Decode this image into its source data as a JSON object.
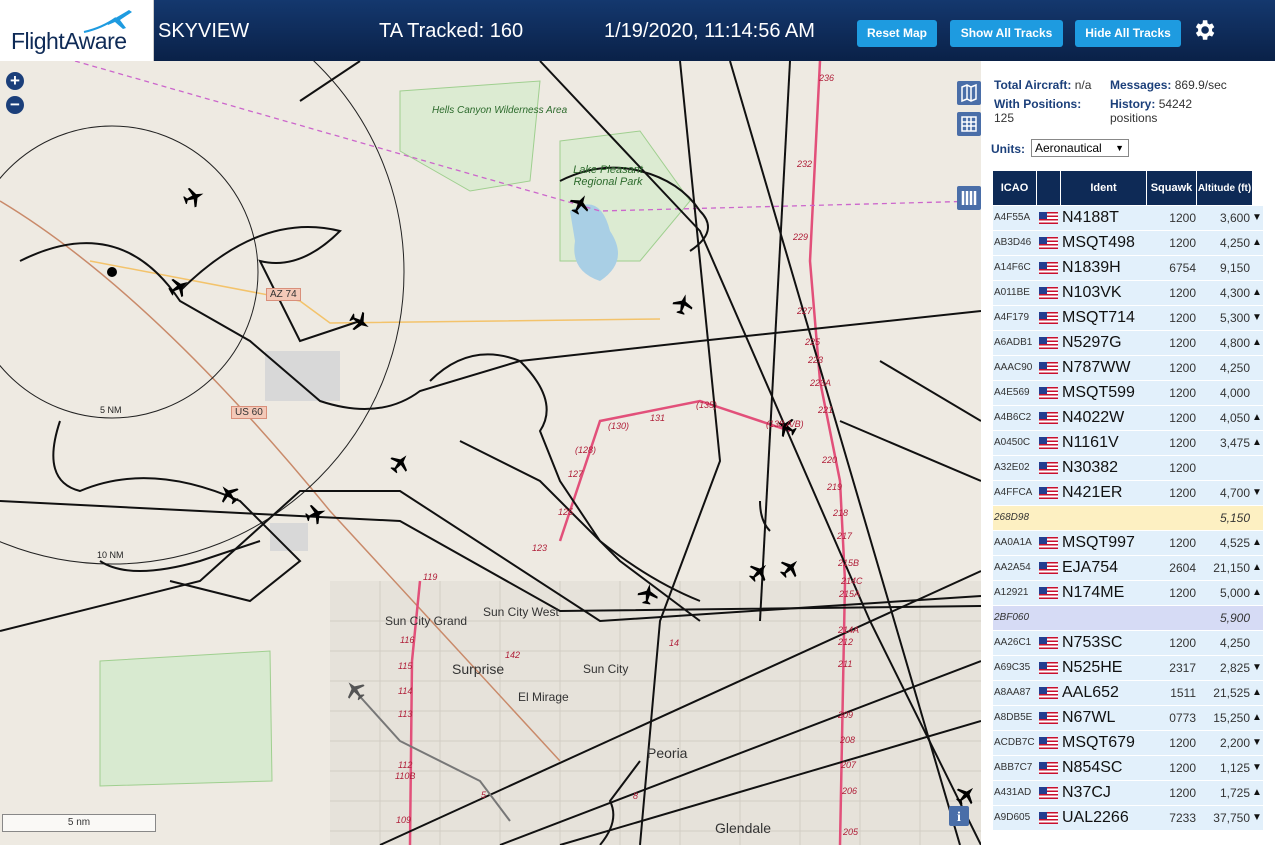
{
  "header": {
    "logo": "FlightAware",
    "app_name": "SKYVIEW",
    "tracked": "TA Tracked: 160",
    "datetime": "1/19/2020, 11:14:56 AM",
    "buttons": {
      "reset": "Reset Map",
      "show_all": "Show All Tracks",
      "hide_all": "Hide All Tracks"
    },
    "settings_icon": "gear-icon"
  },
  "map": {
    "zoom_in": "+",
    "zoom_out": "−",
    "scale": "5 nm",
    "range_labels": {
      "r5": "5 NM",
      "r10": "10 NM"
    },
    "road_badges": {
      "az74": "AZ 74",
      "us60": "US 60"
    },
    "places": {
      "hells_canyon": "Hells Canyon Wilderness Area",
      "lake_pleasant": "Lake Pleasant Regional Park",
      "sun_city_grand": "Sun City Grand",
      "sun_city_west": "Sun City West",
      "surprise": "Surprise",
      "sun_city": "Sun City",
      "el_mirage": "El Mirage",
      "peoria": "Peoria",
      "glendale": "Glendale"
    },
    "exits": [
      "236",
      "232",
      "229",
      "227",
      "225",
      "223",
      "223A",
      "221",
      "220",
      "219",
      "218",
      "217",
      "215B",
      "214C",
      "215A",
      "214A",
      "212",
      "211",
      "209",
      "208",
      "207",
      "206",
      "205",
      "119",
      "116",
      "115",
      "114",
      "113",
      "112",
      "110B",
      "109",
      "142",
      "131",
      "(130)",
      "(135)",
      "(128)",
      "127",
      "125",
      "123",
      "(138 A/B)",
      "14",
      "8",
      "5"
    ],
    "icons": {
      "map_view": "map-icon",
      "grid": "grid-icon",
      "columns": "columns-icon",
      "info": "info-icon"
    }
  },
  "sidebar": {
    "total_aircraft_label": "Total Aircraft:",
    "total_aircraft_value": "n/a",
    "messages_label": "Messages:",
    "messages_value": "869.9/sec",
    "with_positions_label": "With Positions:",
    "with_positions_value": "125",
    "history_label": "History:",
    "history_value": "54242 positions",
    "units_label": "Units:",
    "units_value": "Aeronautical",
    "columns": [
      "ICAO",
      "",
      "Ident",
      "Squawk",
      "Altitude (ft)"
    ],
    "rows": [
      {
        "icao": "A4F55A",
        "flag": true,
        "ident": "N4188T",
        "squawk": "1200",
        "alt": "3,600",
        "trend": "▼",
        "bg": "#e2f0fb"
      },
      {
        "icao": "AB3D46",
        "flag": true,
        "ident": "MSQT498",
        "squawk": "1200",
        "alt": "4,250",
        "trend": "▲",
        "bg": "#e2f0fb"
      },
      {
        "icao": "A14F6C",
        "flag": true,
        "ident": "N1839H",
        "squawk": "6754",
        "alt": "9,150",
        "trend": "",
        "bg": "#e2f0fb"
      },
      {
        "icao": "A011BE",
        "flag": true,
        "ident": "N103VK",
        "squawk": "1200",
        "alt": "4,300",
        "trend": "▲",
        "bg": "#e2f0fb"
      },
      {
        "icao": "A4F179",
        "flag": true,
        "ident": "MSQT714",
        "squawk": "1200",
        "alt": "5,300",
        "trend": "▼",
        "bg": "#e2f0fb"
      },
      {
        "icao": "A6ADB1",
        "flag": true,
        "ident": "N5297G",
        "squawk": "1200",
        "alt": "4,800",
        "trend": "▲",
        "bg": "#e2f0fb"
      },
      {
        "icao": "AAAC90",
        "flag": true,
        "ident": "N787WW",
        "squawk": "1200",
        "alt": "4,250",
        "trend": "",
        "bg": "#e2f0fb"
      },
      {
        "icao": "A4E569",
        "flag": true,
        "ident": "MSQT599",
        "squawk": "1200",
        "alt": "4,000",
        "trend": "",
        "bg": "#e2f0fb"
      },
      {
        "icao": "A4B6C2",
        "flag": true,
        "ident": "N4022W",
        "squawk": "1200",
        "alt": "4,050",
        "trend": "▲",
        "bg": "#e2f0fb"
      },
      {
        "icao": "A0450C",
        "flag": true,
        "ident": "N1161V",
        "squawk": "1200",
        "alt": "3,475",
        "trend": "▲",
        "bg": "#e2f0fb"
      },
      {
        "icao": "A32E02",
        "flag": true,
        "ident": "N30382",
        "squawk": "1200",
        "alt": "",
        "trend": "",
        "bg": "#e2f0fb"
      },
      {
        "icao": "A4FFCA",
        "flag": true,
        "ident": "N421ER",
        "squawk": "1200",
        "alt": "4,700",
        "trend": "▼",
        "bg": "#e2f0fb"
      },
      {
        "icao": "268D98",
        "flag": false,
        "ident": "",
        "squawk": "",
        "alt": "5,150",
        "trend": "",
        "bg": "#fdf0c2",
        "italic": true
      },
      {
        "icao": "AA0A1A",
        "flag": true,
        "ident": "MSQT997",
        "squawk": "1200",
        "alt": "4,525",
        "trend": "▲",
        "bg": "#e2f0fb"
      },
      {
        "icao": "AA2A54",
        "flag": true,
        "ident": "EJA754",
        "squawk": "2604",
        "alt": "21,150",
        "trend": "▲",
        "bg": "#e2f0fb"
      },
      {
        "icao": "A12921",
        "flag": true,
        "ident": "N174ME",
        "squawk": "1200",
        "alt": "5,000",
        "trend": "▲",
        "bg": "#e2f0fb"
      },
      {
        "icao": "2BF060",
        "flag": false,
        "ident": "",
        "squawk": "",
        "alt": "5,900",
        "trend": "",
        "bg": "#d6dbf5",
        "italic": true
      },
      {
        "icao": "AA26C1",
        "flag": true,
        "ident": "N753SC",
        "squawk": "1200",
        "alt": "4,250",
        "trend": "",
        "bg": "#e2f0fb"
      },
      {
        "icao": "A69C35",
        "flag": true,
        "ident": "N525HE",
        "squawk": "2317",
        "alt": "2,825",
        "trend": "▼",
        "bg": "#e2f0fb"
      },
      {
        "icao": "A8AA87",
        "flag": true,
        "ident": "AAL652",
        "squawk": "1511",
        "alt": "21,525",
        "trend": "▲",
        "bg": "#e2f0fb"
      },
      {
        "icao": "A8DB5E",
        "flag": true,
        "ident": "N67WL",
        "squawk": "0773",
        "alt": "15,250",
        "trend": "▲",
        "bg": "#e2f0fb"
      },
      {
        "icao": "ACDB7C",
        "flag": true,
        "ident": "MSQT679",
        "squawk": "1200",
        "alt": "2,200",
        "trend": "▼",
        "bg": "#e2f0fb"
      },
      {
        "icao": "ABB7C7",
        "flag": true,
        "ident": "N854SC",
        "squawk": "1200",
        "alt": "1,125",
        "trend": "▼",
        "bg": "#e2f0fb"
      },
      {
        "icao": "A431AD",
        "flag": true,
        "ident": "N37CJ",
        "squawk": "1200",
        "alt": "1,725",
        "trend": "▲",
        "bg": "#e2f0fb"
      },
      {
        "icao": "A9D605",
        "flag": true,
        "ident": "UAL2266",
        "squawk": "7233",
        "alt": "37,750",
        "trend": "▼",
        "bg": "#e2f0fb"
      }
    ]
  }
}
